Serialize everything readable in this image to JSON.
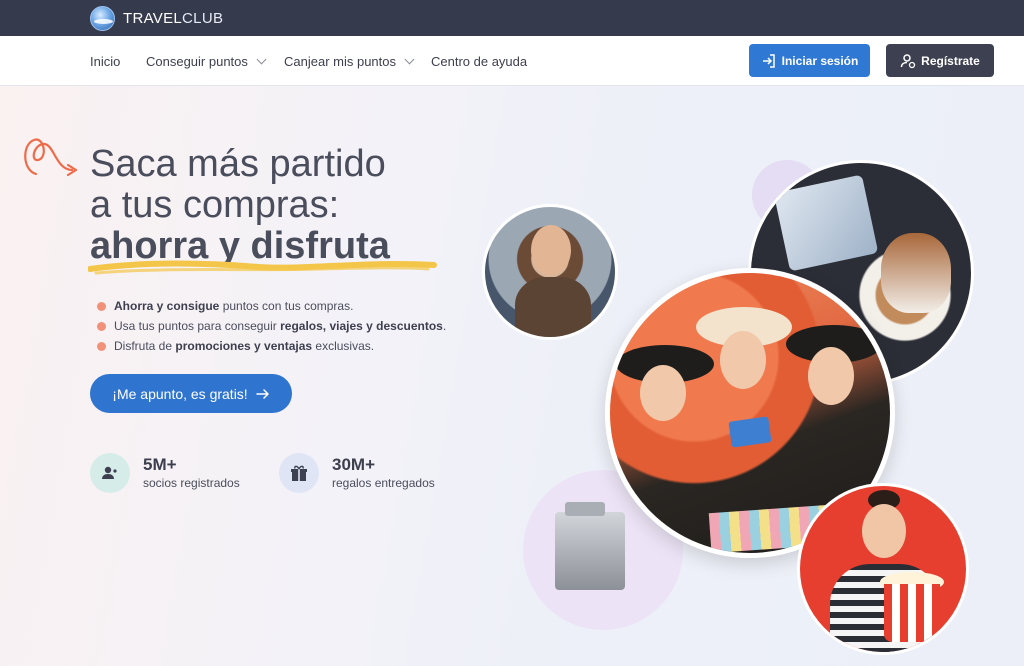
{
  "brand": {
    "name_bold": "TRAVEL",
    "name_light": "CLUB"
  },
  "nav": {
    "items": [
      {
        "label": "Inicio",
        "dropdown": false
      },
      {
        "label": "Conseguir puntos",
        "dropdown": true
      },
      {
        "label": "Canjear mis puntos",
        "dropdown": true
      },
      {
        "label": "Centro de ayuda",
        "dropdown": false
      }
    ],
    "login_label": "Iniciar sesión",
    "register_label": "Regístrate"
  },
  "hero": {
    "headline_line1": "Saca más partido",
    "headline_line2": "a tus compras:",
    "headline_strong": "ahorra y disfruta",
    "bullets": [
      {
        "b1": "Ahorra y consigue",
        "t1": " puntos con tus compras.",
        "b2": "",
        "t2": ""
      },
      {
        "b1": "",
        "t1": "Usa tus puntos para conseguir ",
        "b2": "regalos, viajes y descuentos",
        "t2": "."
      },
      {
        "b1": "",
        "t1": "Disfruta de ",
        "b2": "promociones y ventajas",
        "t2": " exclusivas."
      }
    ],
    "cta_label": "¡Me apunto, es gratis!"
  },
  "stats": [
    {
      "number": "5M+",
      "label": "socios registrados",
      "icon": "users-icon"
    },
    {
      "number": "30M+",
      "label": "regalos entregados",
      "icon": "gift-icon"
    }
  ],
  "colors": {
    "primary": "#2f74cf",
    "dark_button": "#3d4050",
    "topbar": "#353a4d",
    "accent_orange": "#f1917a",
    "underline_yellow": "#f3c64a"
  }
}
